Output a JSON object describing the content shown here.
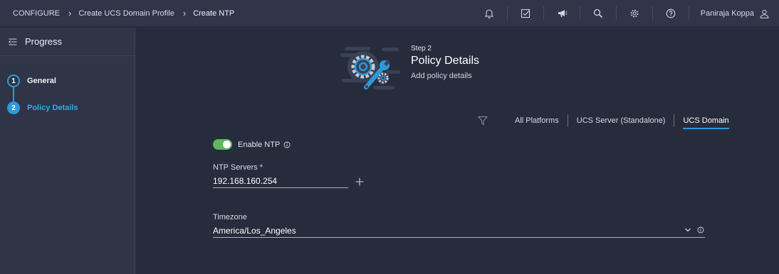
{
  "breadcrumbs": [
    "CONFIGURE",
    "Create UCS Domain Profile",
    "Create NTP"
  ],
  "header": {
    "icons": [
      "bell-icon",
      "checklist-icon",
      "megaphone-icon",
      "search-icon",
      "gear-icon",
      "help-icon"
    ],
    "user_name": "Paniraja Koppa"
  },
  "sidebar": {
    "title": "Progress",
    "steps": [
      {
        "number": "1",
        "label": "General",
        "state": "done"
      },
      {
        "number": "2",
        "label": "Policy Details",
        "state": "active"
      }
    ]
  },
  "main": {
    "step_number": "Step 2",
    "title": "Policy Details",
    "subtitle": "Add policy details",
    "filters": [
      "All Platforms",
      "UCS Server (Standalone)",
      "UCS Domain"
    ],
    "active_filter": "UCS Domain",
    "enable_ntp": {
      "label": "Enable NTP",
      "on": true
    },
    "ntp_servers": {
      "label": "NTP Servers *",
      "value": "192.168.160.254"
    },
    "timezone": {
      "label": "Timezone",
      "value": "America/Los_Angeles"
    }
  },
  "colors": {
    "accent": "#2d9ad8",
    "toggle_on": "#5cb85c",
    "background": "#272c3d"
  }
}
